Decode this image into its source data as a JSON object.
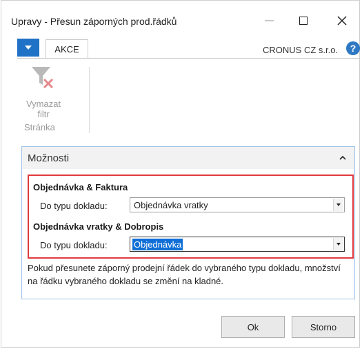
{
  "window": {
    "title": "Upravy - Přesun záporných prod.řádků"
  },
  "ribbon": {
    "tab_label": "AKCE",
    "company": "CRONUS CZ s.r.o.",
    "help_glyph": "?",
    "clear_filter_label": "Vymazat filtr",
    "group_label": "Stránka",
    "icons": {
      "app_menu": "dropdown-arrow-icon",
      "clear_filter": "clear-filter-icon",
      "help": "help-icon"
    }
  },
  "options": {
    "header": "Možnosti",
    "sections": [
      {
        "title": "Objednávka & Faktura",
        "field_label": "Do typu dokladu:",
        "value": "Objednávka vratky"
      },
      {
        "title": "Objednávka vratky & Dobropis",
        "field_label": "Do typu dokladu:",
        "value": "Objednávka"
      }
    ],
    "note": "Pokud přesunete záporný prodejní řádek do vybraného typu dokladu, množství na řádku vybraného dokladu se změní na kladné."
  },
  "buttons": {
    "ok": "Ok",
    "cancel": "Storno"
  },
  "colors": {
    "accent_blue": "#1f72c6",
    "highlight_red": "#e0393e",
    "selection_blue": "#0f6fd6",
    "panel_border": "#9dc3e8"
  }
}
